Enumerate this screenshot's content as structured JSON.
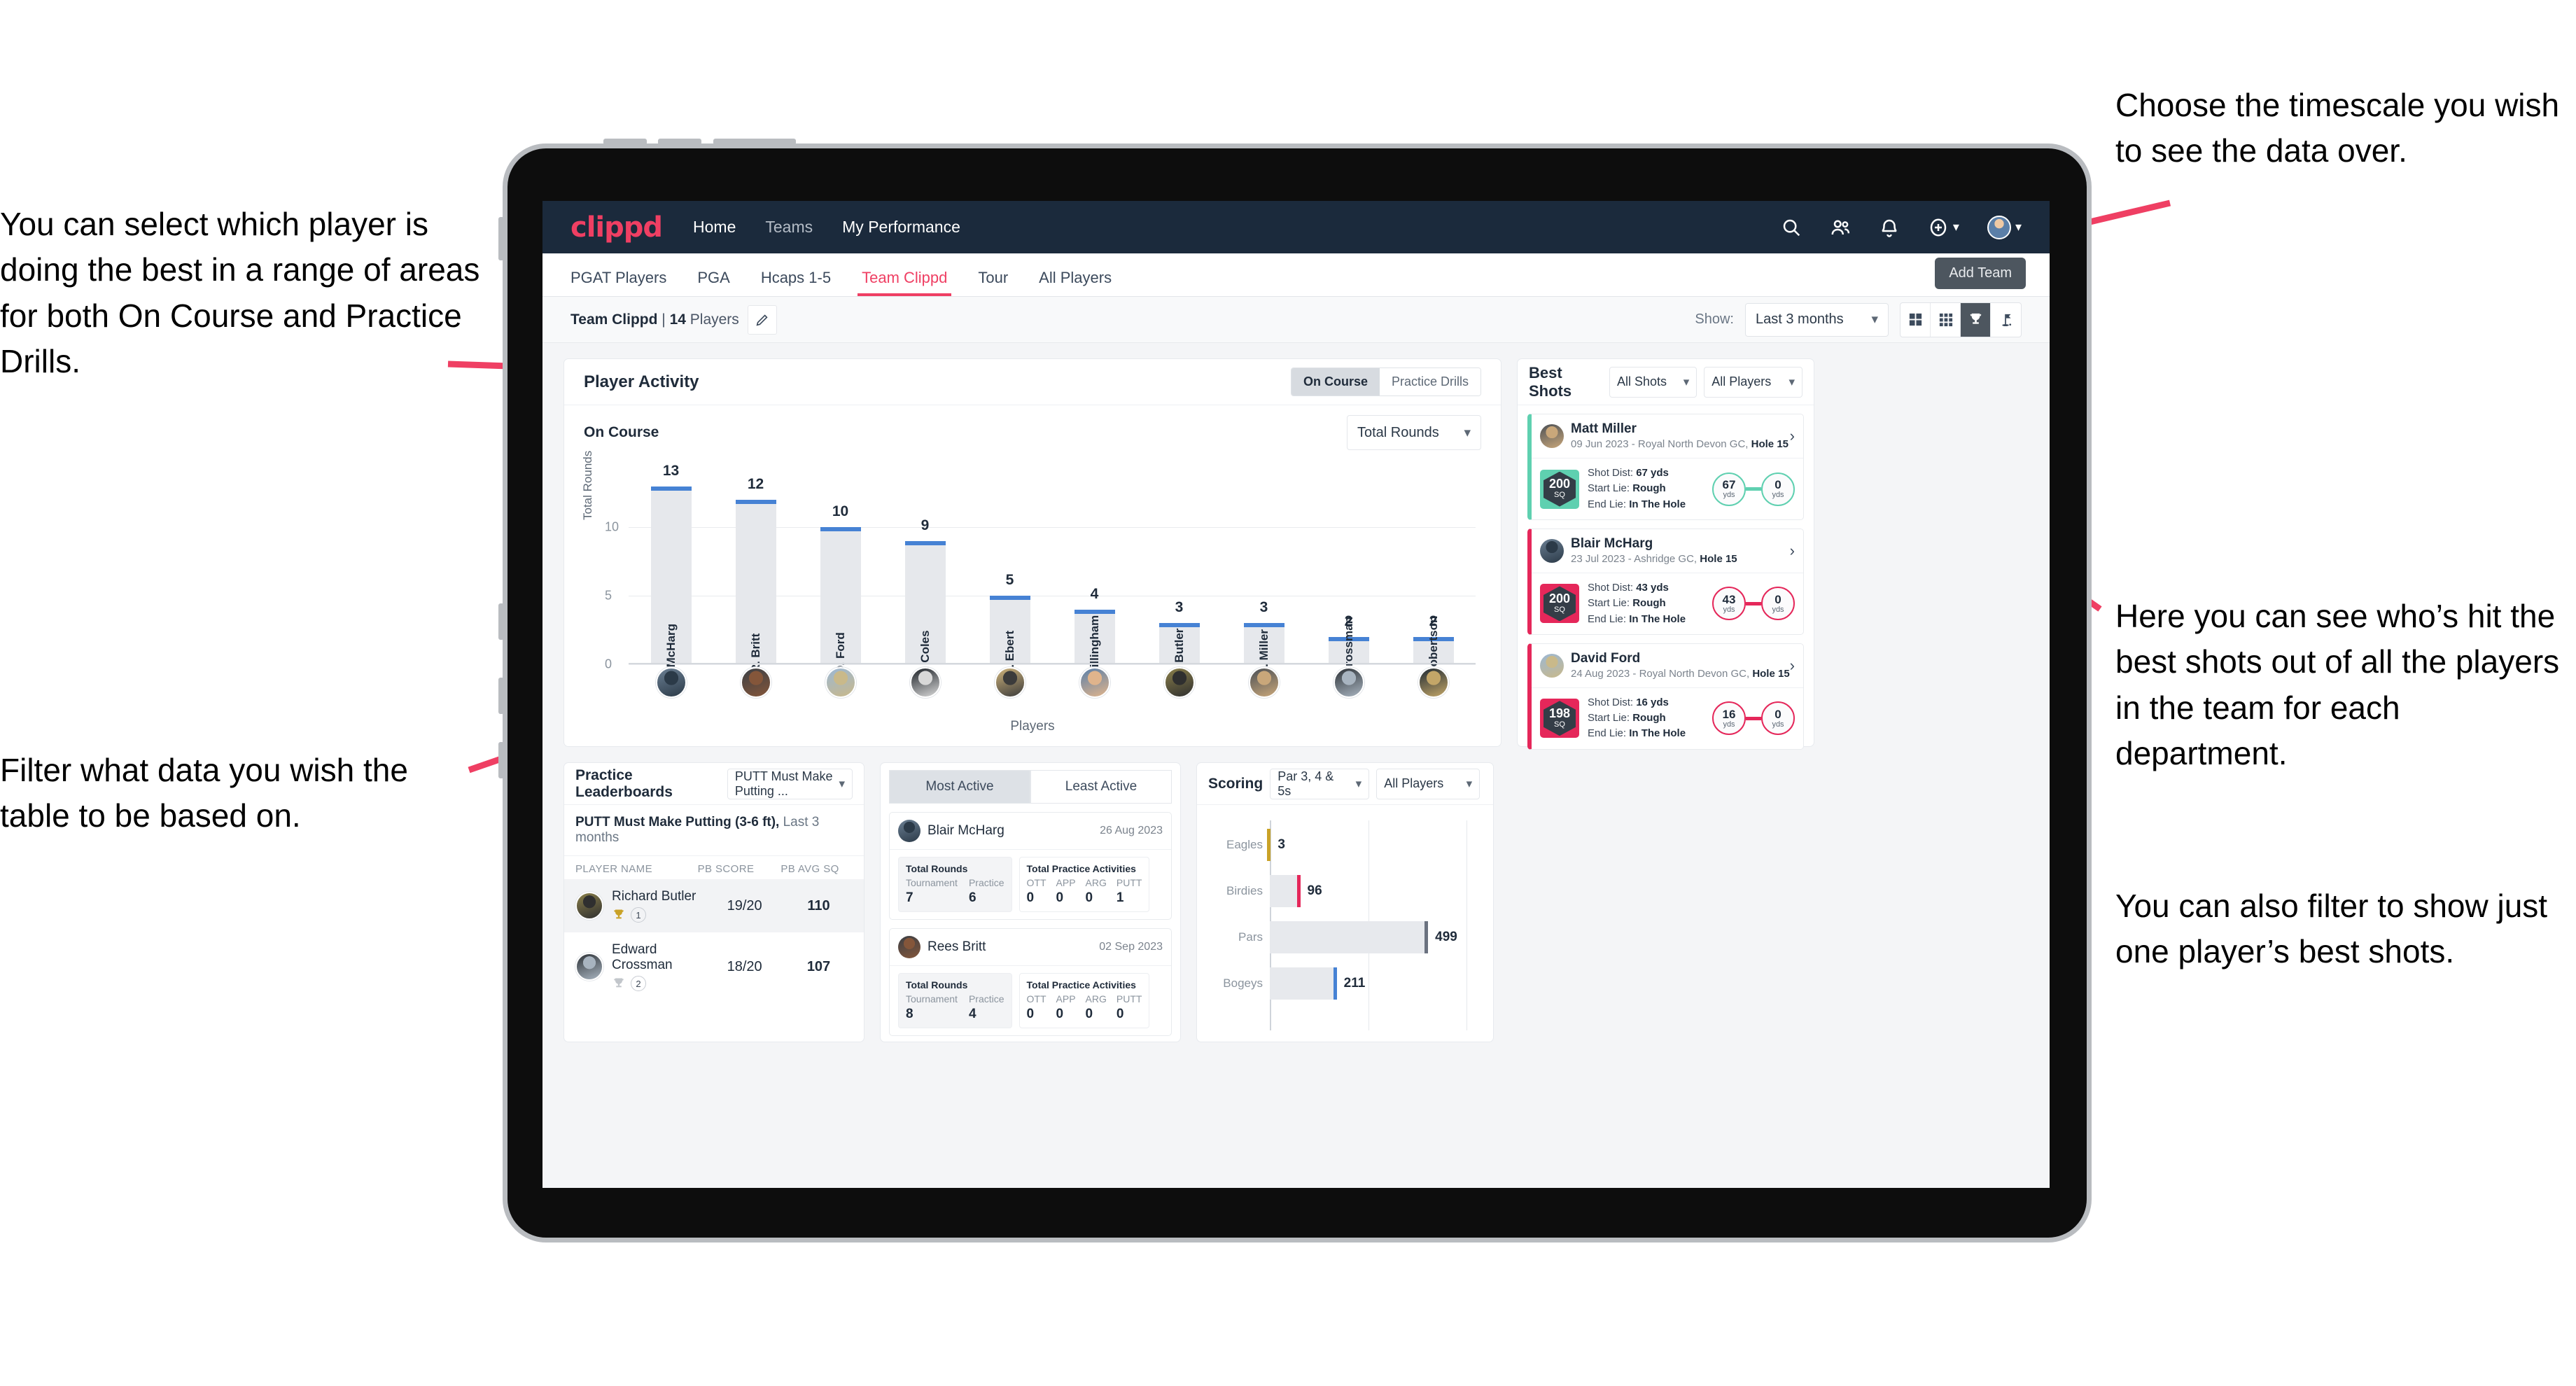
{
  "annotations": {
    "left_top": "You can select which player is doing the best in a range of areas for both On Course and Practice Drills.",
    "left_bottom": "Filter what data you wish the table to be based on.",
    "right_top": "Choose the timescale you wish to see the data over.",
    "right_mid": "Here you can see who’s hit the best shots out of all the players in the team for each department.",
    "right_bottom": "You can also filter to show just one player’s best shots."
  },
  "navbar": {
    "logo": "clippd",
    "links": [
      {
        "label": "Home",
        "active": true
      },
      {
        "label": "Teams",
        "active": false
      },
      {
        "label": "My Performance",
        "active": true
      }
    ],
    "icons": [
      "search-icon",
      "people-icon",
      "bell-icon",
      "plus-circle-icon",
      "avatar"
    ]
  },
  "tabs": {
    "items": [
      {
        "label": "PGAT Players",
        "active": false
      },
      {
        "label": "PGA",
        "active": false
      },
      {
        "label": "Hcaps 1-5",
        "active": false
      },
      {
        "label": "Team Clippd",
        "active": true
      },
      {
        "label": "Tour",
        "active": false
      },
      {
        "label": "All Players",
        "active": false
      }
    ],
    "tooltip": "Add Team"
  },
  "toolbar": {
    "team_name": "Team Clippd",
    "team_sep": " | ",
    "player_count": "14",
    "player_word": " Players",
    "edit_icon": "pencil-icon",
    "show_label": "Show:",
    "range_value": "Last 3 months",
    "views": [
      {
        "name": "grid-large-icon",
        "active": false
      },
      {
        "name": "grid-small-icon",
        "active": false
      },
      {
        "name": "trophy-icon",
        "active": true
      },
      {
        "name": "golf-flag-icon",
        "active": false
      }
    ]
  },
  "player_activity": {
    "title": "Player Activity",
    "toggle": [
      {
        "label": "On Course",
        "active": true
      },
      {
        "label": "Practice Drills",
        "active": false
      }
    ],
    "section_label": "On Course",
    "metric_value": "Total Rounds"
  },
  "best_shots": {
    "title": "Best Shots",
    "shot_filter": "All Shots",
    "player_filter": "All Players",
    "labels": {
      "shot_dist": "Shot Dist:",
      "start_lie": "Start Lie:",
      "end_lie": "End Lie:",
      "yds": "yds",
      "sq": "SQ"
    },
    "items": [
      {
        "player": "Matt Miller",
        "meta_date": "09 Jun 2023 - Royal North Devon GC, ",
        "meta_hole": "Hole 15",
        "sq": "200",
        "shot_dist": "67 yds",
        "start_lie": "Rough",
        "end_lie": "In The Hole",
        "from_dist": "67",
        "to_dist": "0",
        "accent": "#5fd0b0"
      },
      {
        "player": "Blair McHarg",
        "meta_date": "23 Jul 2023 - Ashridge GC, ",
        "meta_hole": "Hole 15",
        "sq": "200",
        "shot_dist": "43 yds",
        "start_lie": "Rough",
        "end_lie": "In The Hole",
        "from_dist": "43",
        "to_dist": "0",
        "accent": "#e5275a"
      },
      {
        "player": "David Ford",
        "meta_date": "24 Aug 2023 - Royal North Devon GC, ",
        "meta_hole": "Hole 15",
        "sq": "198",
        "shot_dist": "16 yds",
        "start_lie": "Rough",
        "end_lie": "In The Hole",
        "from_dist": "16",
        "to_dist": "0",
        "accent": "#e5275a"
      }
    ]
  },
  "practice_leaderboards": {
    "title": "Practice Leaderboards",
    "drill_select": "PUTT Must Make Putting ...",
    "subtitle_bold": "PUTT Must Make Putting (3-6 ft),",
    "subtitle_rest": " Last 3 months",
    "columns": [
      "PLAYER NAME",
      "PB SCORE",
      "PB AVG SQ"
    ],
    "rows": [
      {
        "name": "Richard Butler",
        "rank": "1",
        "trophy": "gold",
        "pb_score": "19/20",
        "pb_avg_sq": "110",
        "highlight": true
      },
      {
        "name": "Edward Crossman",
        "rank": "2",
        "trophy": "silver",
        "pb_score": "18/20",
        "pb_avg_sq": "107",
        "highlight": false
      }
    ]
  },
  "activity_panel": {
    "tabs": [
      {
        "label": "Most Active",
        "active": true
      },
      {
        "label": "Least Active",
        "active": false
      }
    ],
    "box_labels": {
      "rounds": "Total Rounds",
      "tournament": "Tournament",
      "practice": "Practice",
      "activities": "Total Practice Activities",
      "ott": "OTT",
      "app": "APP",
      "arg": "ARG",
      "putt": "PUTT"
    },
    "items": [
      {
        "player": "Blair McHarg",
        "date": "26 Aug 2023",
        "tournament": "7",
        "practice": "6",
        "ott": "0",
        "app": "0",
        "arg": "0",
        "putt": "1"
      },
      {
        "player": "Rees Britt",
        "date": "02 Sep 2023",
        "tournament": "8",
        "practice": "4",
        "ott": "0",
        "app": "0",
        "arg": "0",
        "putt": "0"
      }
    ]
  },
  "scoring": {
    "title": "Scoring",
    "par_filter": "Par 3, 4 & 5s",
    "player_filter": "All Players"
  },
  "chart_data": [
    {
      "type": "bar",
      "title": "Player Activity - On Course",
      "xlabel": "Players",
      "ylabel": "Total Rounds",
      "ylim": [
        0,
        14
      ],
      "yticks": [
        0,
        5,
        10
      ],
      "grid": true,
      "bar_color": "#e6e8ec",
      "cap_color": "#4682d4",
      "categories": [
        "B. McHarg",
        "R. Britt",
        "D. Ford",
        "J. Coles",
        "E. Ebert",
        "D. Billingham",
        "R. Butler",
        "M. Miller",
        "E. Crossman",
        "C. Robertson"
      ],
      "values": [
        13,
        12,
        10,
        9,
        5,
        4,
        3,
        3,
        2,
        2
      ]
    },
    {
      "type": "bar",
      "orientation": "horizontal",
      "title": "Scoring",
      "xlabel": "",
      "ylabel": "",
      "xlim": [
        0,
        620
      ],
      "grid": true,
      "categories": [
        "Eagles",
        "Birdies",
        "Pars",
        "Bogeys"
      ],
      "values": [
        3,
        96,
        499,
        211
      ],
      "cap_colors": [
        "#c9a227",
        "#e5275a",
        "#6b7280",
        "#4682d4"
      ]
    }
  ]
}
